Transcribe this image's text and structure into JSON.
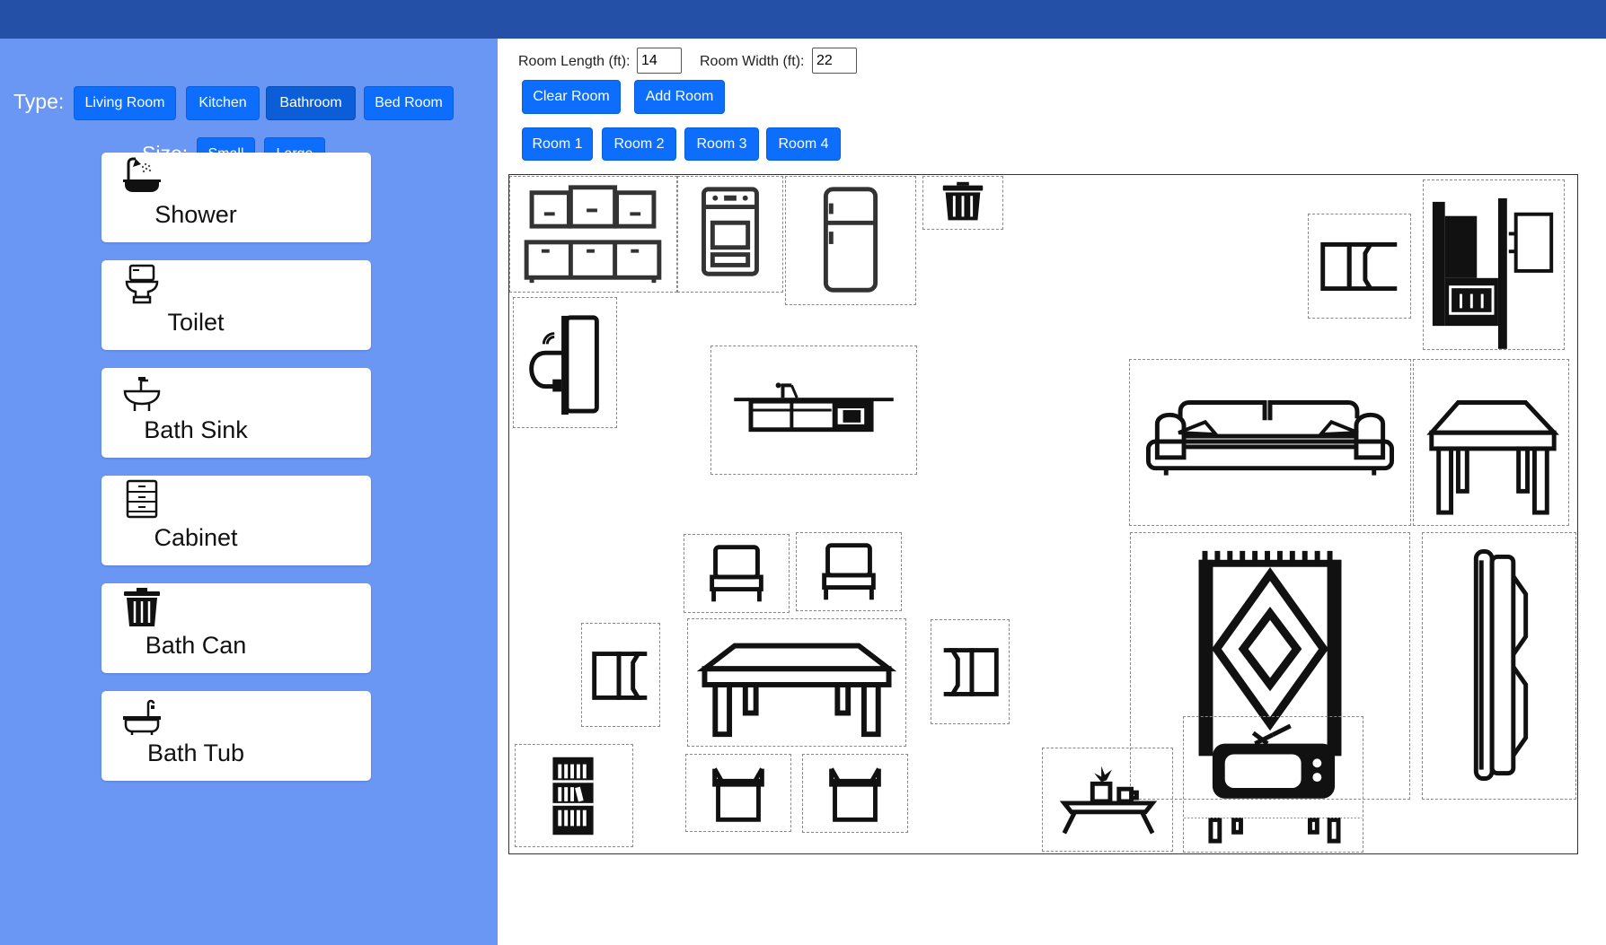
{
  "sidebar": {
    "type_label": "Type:",
    "type_buttons": [
      "Living Room",
      "Kitchen",
      "Bathroom",
      "Bed Room"
    ],
    "active_type": "Bathroom",
    "size_label": "Size:",
    "size_buttons": [
      "Small",
      "Large"
    ],
    "items": [
      {
        "label": "Shower",
        "icon": "shower-icon"
      },
      {
        "label": "Toilet",
        "icon": "toilet-icon"
      },
      {
        "label": "Bath Sink",
        "icon": "bath-sink-icon"
      },
      {
        "label": "Cabinet",
        "icon": "cabinet-icon"
      },
      {
        "label": "Bath Can",
        "icon": "trash-can-icon"
      },
      {
        "label": "Bath Tub",
        "icon": "bathtub-icon"
      }
    ]
  },
  "main": {
    "length_label": "Room Length (ft):",
    "length_value": "14",
    "width_label": "Room Width (ft):",
    "width_value": "22",
    "clear_label": "Clear Room",
    "add_label": "Add Room",
    "rooms": [
      "Room 1",
      "Room 2",
      "Room 3",
      "Room 4"
    ]
  },
  "colors": {
    "topbar": "#2450a8",
    "sidebar": "#6a96f4",
    "button": "#0d6efd"
  },
  "room_items": [
    "kitchen-cabinets-icon",
    "stove-icon",
    "fridge-icon",
    "trash-can-icon",
    "chair-side-icon",
    "bed-side-icon",
    "wall-sink-icon",
    "counter-sink-icon",
    "sofa-icon",
    "table-icon",
    "chair-icon",
    "chair-icon",
    "rug-icon",
    "sofa-side-icon",
    "chair-side-icon",
    "dining-table-icon",
    "chair-side-icon",
    "bookshelf-icon",
    "chair-back-icon",
    "chair-back-icon",
    "coffee-table-icon",
    "tv-icon"
  ]
}
